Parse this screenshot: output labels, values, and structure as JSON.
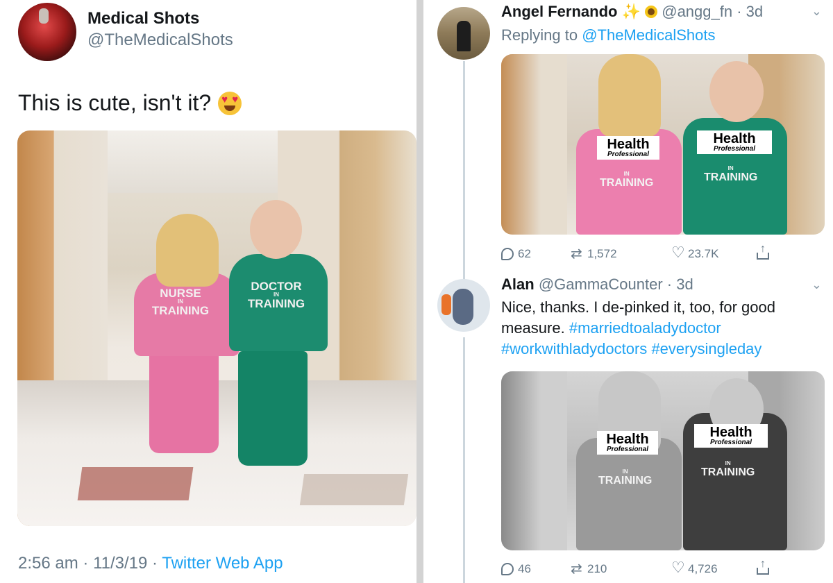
{
  "left_tweet": {
    "author_name": "Medical Shots",
    "author_handle": "@TheMedicalShots",
    "text": "This is cute, isn't it?",
    "emoji": "heart-eyes-emoji",
    "photo": {
      "nurse_shirt_top": "NURSE",
      "nurse_shirt_mid": "IN",
      "nurse_shirt_bottom": "TRAINING",
      "doctor_shirt_top": "DOCTOR",
      "doctor_shirt_mid": "IN",
      "doctor_shirt_bottom": "TRAINING"
    },
    "time": "2:56 am",
    "date": "11/3/19",
    "source": "Twitter Web App",
    "separator": "·"
  },
  "reply1": {
    "author_name": "Angel Fernando",
    "author_handle": "@angg_fn",
    "age": "3d",
    "replying_prefix": "Replying to",
    "replying_to": "@TheMedicalShots",
    "image_labels": {
      "pink_health": "Health",
      "pink_professional": "Professional",
      "pink_in": "IN",
      "pink_training": "TRAINING",
      "green_health": "Health",
      "green_professional": "Professional",
      "green_in": "IN",
      "green_training": "TRAINING"
    },
    "stats": {
      "replies": "62",
      "retweets": "1,572",
      "likes": "23.7K"
    }
  },
  "reply2": {
    "author_name": "Alan",
    "author_handle": "@GammaCounter",
    "age": "3d",
    "text": "Nice, thanks. I de-pinked it, too, for good measure.",
    "hashtags": [
      "#marriedtoaladydoctor",
      "#workwithladydoctors",
      "#everysingleday"
    ],
    "image_labels": {
      "left_health": "Health",
      "left_professional": "Professional",
      "left_in": "IN",
      "left_training": "TRAINING",
      "right_health": "Health",
      "right_professional": "Professional",
      "right_in": "IN",
      "right_training": "TRAINING"
    },
    "stats": {
      "replies": "46",
      "retweets": "210",
      "likes": "4,726"
    }
  },
  "colors": {
    "link": "#1da1f2",
    "muted": "#657786",
    "text": "#14171a",
    "divider": "#d3d3d3"
  }
}
